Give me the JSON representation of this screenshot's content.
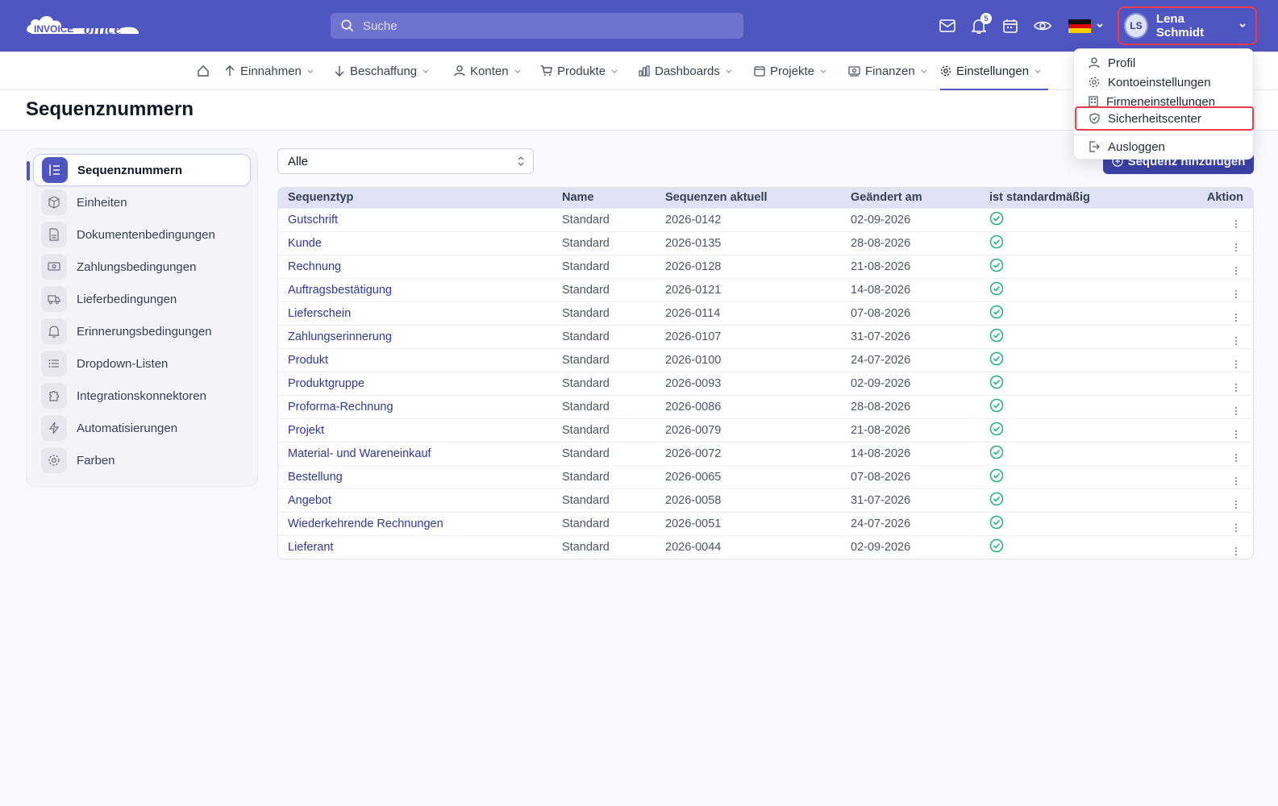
{
  "app": {
    "logo_word1": "INVOICE",
    "logo_word2": "office",
    "brand_color": "#4f56c2"
  },
  "search": {
    "placeholder": "Suche"
  },
  "header_icons": {
    "mail": "mail-icon",
    "notifications": "bell-icon",
    "notifications_count": "5",
    "calendar": "calendar-icon",
    "preview": "eye-icon",
    "language": "germany-flag-icon"
  },
  "user": {
    "initials": "LS",
    "name": "Lena Schmidt"
  },
  "nav": {
    "items": [
      {
        "label": "Einnahmen",
        "icon": "arrow-up-icon"
      },
      {
        "label": "Beschaffung",
        "icon": "arrow-down-icon"
      },
      {
        "label": "Konten",
        "icon": "person-icon"
      },
      {
        "label": "Produkte",
        "icon": "cart-icon"
      },
      {
        "label": "Dashboards",
        "icon": "bar-chart-icon"
      },
      {
        "label": "Projekte",
        "icon": "calendar-icon"
      },
      {
        "label": "Finanzen",
        "icon": "money-icon"
      },
      {
        "label": "Einstellungen",
        "icon": "gear-icon"
      }
    ]
  },
  "page": {
    "title": "Sequenznummern"
  },
  "sidebar": {
    "items": [
      {
        "label": "Sequenznummern",
        "icon": "list-numbered-icon"
      },
      {
        "label": "Einheiten",
        "icon": "cube-icon"
      },
      {
        "label": "Dokumentenbedingungen",
        "icon": "document-icon"
      },
      {
        "label": "Zahlungsbedingungen",
        "icon": "banknote-icon"
      },
      {
        "label": "Lieferbedingungen",
        "icon": "truck-icon"
      },
      {
        "label": "Erinnerungsbedingungen",
        "icon": "bell-icon"
      },
      {
        "label": "Dropdown-Listen",
        "icon": "list-icon"
      },
      {
        "label": "Integrationskonnektoren",
        "icon": "puzzle-icon"
      },
      {
        "label": "Automatisierungen",
        "icon": "lightning-icon"
      },
      {
        "label": "Farben",
        "icon": "gear-icon"
      }
    ]
  },
  "filter": {
    "selected": "Alle"
  },
  "add_button": {
    "label": "Sequenz hinzufügen"
  },
  "table": {
    "headers": [
      "Sequenztyp",
      "Name",
      "Sequenzen aktuell",
      "Geändert am",
      "ist standardmäßig",
      "Aktion"
    ],
    "rows": [
      {
        "type": "Gutschrift",
        "name": "Standard",
        "current": "2026-0142",
        "changed": "02-09-2026",
        "default": true
      },
      {
        "type": "Kunde",
        "name": "Standard",
        "current": "2026-0135",
        "changed": "28-08-2026",
        "default": true
      },
      {
        "type": "Rechnung",
        "name": "Standard",
        "current": "2026-0128",
        "changed": "21-08-2026",
        "default": true
      },
      {
        "type": "Auftragsbestätigung",
        "name": "Standard",
        "current": "2026-0121",
        "changed": "14-08-2026",
        "default": true
      },
      {
        "type": "Lieferschein",
        "name": "Standard",
        "current": "2026-0114",
        "changed": "07-08-2026",
        "default": true
      },
      {
        "type": "Zahlungserinnerung",
        "name": "Standard",
        "current": "2026-0107",
        "changed": "31-07-2026",
        "default": true
      },
      {
        "type": "Produkt",
        "name": "Standard",
        "current": "2026-0100",
        "changed": "24-07-2026",
        "default": true
      },
      {
        "type": "Produktgruppe",
        "name": "Standard",
        "current": "2026-0093",
        "changed": "02-09-2026",
        "default": true
      },
      {
        "type": "Proforma-Rechnung",
        "name": "Standard",
        "current": "2026-0086",
        "changed": "28-08-2026",
        "default": true
      },
      {
        "type": "Projekt",
        "name": "Standard",
        "current": "2026-0079",
        "changed": "21-08-2026",
        "default": true
      },
      {
        "type": "Material- und Wareneinkauf",
        "name": "Standard",
        "current": "2026-0072",
        "changed": "14-08-2026",
        "default": true
      },
      {
        "type": "Bestellung",
        "name": "Standard",
        "current": "2026-0065",
        "changed": "07-08-2026",
        "default": true
      },
      {
        "type": "Angebot",
        "name": "Standard",
        "current": "2026-0058",
        "changed": "31-07-2026",
        "default": true
      },
      {
        "type": "Wiederkehrende Rechnungen",
        "name": "Standard",
        "current": "2026-0051",
        "changed": "24-07-2026",
        "default": true
      },
      {
        "type": "Lieferant",
        "name": "Standard",
        "current": "2026-0044",
        "changed": "02-09-2026",
        "default": true
      }
    ]
  },
  "user_menu": {
    "items": [
      {
        "label": "Profil",
        "icon": "person-icon"
      },
      {
        "label": "Kontoeinstellungen",
        "icon": "gear-icon"
      },
      {
        "label": "Firmeneinstellungen",
        "icon": "building-icon"
      },
      {
        "label": "Sicherheitscenter",
        "icon": "shield-icon"
      },
      {
        "label": "Ausloggen",
        "icon": "logout-icon"
      }
    ]
  },
  "colors": {
    "topbar": "#4f56c2",
    "highlight": "#ef3a4b",
    "check": "#22b07d",
    "link": "#2f3a8f"
  }
}
